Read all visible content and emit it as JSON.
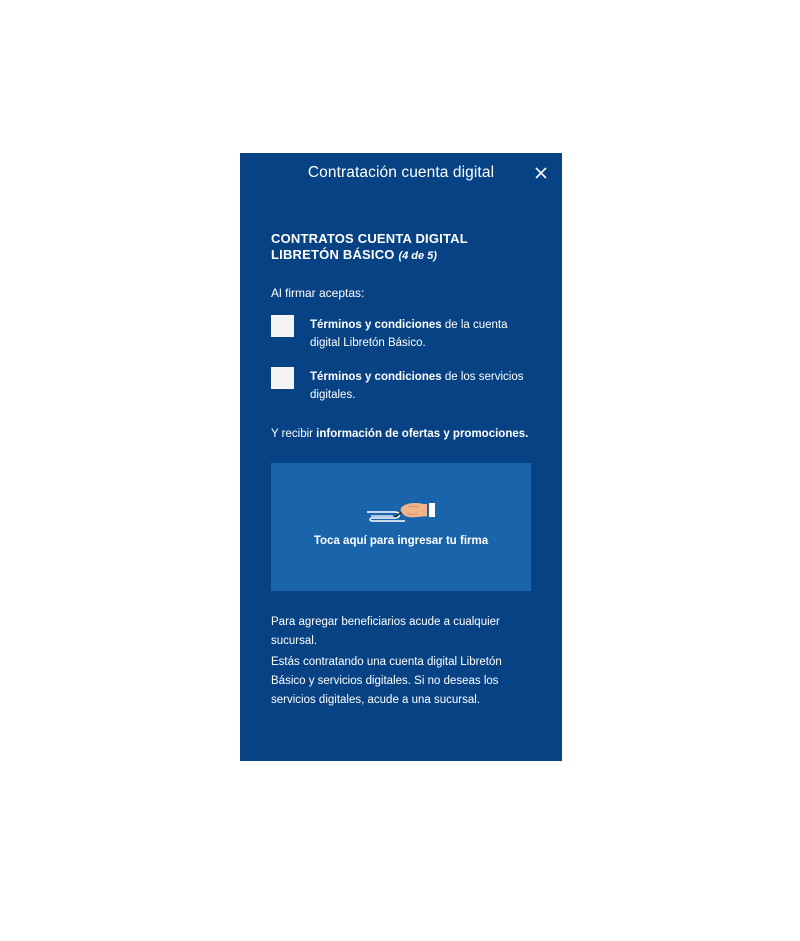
{
  "header": {
    "title": "Contratación cuenta digital",
    "close_icon": "close-icon"
  },
  "section": {
    "title_line1": "CONTRATOS CUENTA DIGITAL",
    "title_line2": "LIBRETÓN BÁSICO",
    "step": "(4 de 5)"
  },
  "intro": "Al firmar aceptas:",
  "checks": [
    {
      "bold": "Términos y condiciones",
      "text": " de la cuenta digital Libretón Básico.",
      "checked": false
    },
    {
      "bold": "Términos y condiciones",
      "text": " de los servicios digitales.",
      "checked": false
    }
  ],
  "offers": {
    "prefix": "Y recibir ",
    "bold": "información de ofertas y promociones."
  },
  "signature": {
    "icon": "signing-hand-icon",
    "label": "Toca aquí para ingresar tu firma"
  },
  "footer": {
    "line1": "Para agregar beneficiarios acude a cualquier sucursal.",
    "line2": "Estás contratando una cuenta digital Libretón Básico y servicios digitales. Si no deseas los servicios digitales, acude a una sucursal."
  },
  "colors": {
    "background": "#074384",
    "sign_box": "#1a64ab",
    "checkbox": "#f4f4f4"
  }
}
